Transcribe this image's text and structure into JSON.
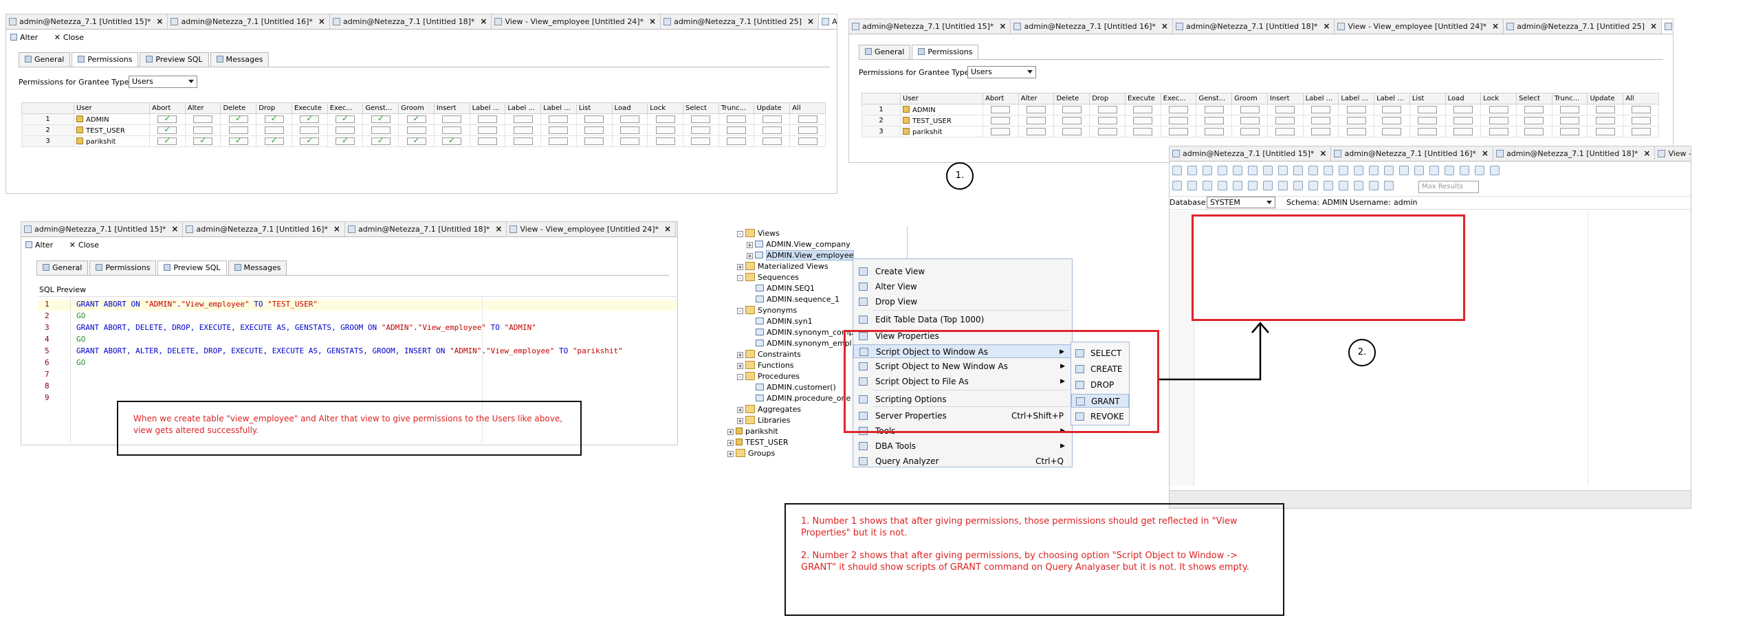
{
  "panel1": {
    "tabs": [
      "admin@Netezza_7.1 [Untitled 15]*",
      "admin@Netezza_7.1 [Untitled 16]*",
      "admin@Netezza_7.1 [Untitled 18]*",
      "View - View_employee [Untitled 24]*",
      "admin@Netezza_7.1 [Untitled 25]",
      "Alter: View: V"
    ],
    "toolbar": {
      "alter": "Alter",
      "close": "Close"
    },
    "subtabs": [
      "General",
      "Permissions",
      "Preview SQL",
      "Messages"
    ],
    "grantee_label": "Permissions for Grantee Type:",
    "grantee_value": "Users",
    "columns": [
      "User",
      "Abort",
      "Alter",
      "Delete",
      "Drop",
      "Execute",
      "Exec...",
      "Genst...",
      "Groom",
      "Insert",
      "Label ...",
      "Label ...",
      "Label ...",
      "List",
      "Load",
      "Lock",
      "Select",
      "Trunc...",
      "Update",
      "All"
    ],
    "rows": [
      {
        "num": "1",
        "user": "ADMIN",
        "checks": [
          1,
          0,
          1,
          1,
          1,
          1,
          1,
          1,
          0,
          0,
          0,
          0,
          0,
          0,
          0,
          0,
          0,
          0,
          0
        ]
      },
      {
        "num": "2",
        "user": "TEST_USER",
        "checks": [
          1,
          0,
          0,
          0,
          0,
          0,
          0,
          0,
          0,
          0,
          0,
          0,
          0,
          0,
          0,
          0,
          0,
          0,
          0
        ]
      },
      {
        "num": "3",
        "user": "parikshit",
        "checks": [
          1,
          1,
          1,
          1,
          1,
          1,
          1,
          1,
          1,
          0,
          0,
          0,
          0,
          0,
          0,
          0,
          0,
          0,
          0
        ]
      }
    ]
  },
  "panel2": {
    "tabs": [
      "admin@Netezza_7.1 [Untitled 15]*",
      "admin@Netezza_7.1 [Untitled 16]*",
      "admin@Netezza_7.1 [Untitled 18]*",
      "View - View_employee [Untitled 24]*",
      "admin@Netezza_7.1 [Untitled 25]",
      "Properties:"
    ],
    "subtabs": [
      "General",
      "Permissions"
    ],
    "grantee_label": "Permissions for Grantee Type:",
    "grantee_value": "Users",
    "columns": [
      "User",
      "Abort",
      "Alter",
      "Delete",
      "Drop",
      "Execute",
      "Exec...",
      "Genst...",
      "Groom",
      "Insert",
      "Label ...",
      "Label ...",
      "Label ...",
      "List",
      "Load",
      "Lock",
      "Select",
      "Trunc...",
      "Update",
      "All"
    ],
    "rows": [
      {
        "num": "1",
        "user": "ADMIN"
      },
      {
        "num": "2",
        "user": "TEST_USER"
      },
      {
        "num": "3",
        "user": "parikshit"
      }
    ]
  },
  "panel3": {
    "tabs": [
      "admin@Netezza_7.1 [Untitled 15]*",
      "admin@Netezza_7.1 [Untitled 16]*",
      "admin@Netezza_7.1 [Untitled 18]*",
      "View - View_employee [Untitled 24]*",
      "admin@Netezza_7.1 [Untitled 25]",
      "View - View_e"
    ],
    "database_label": "Database:",
    "database_value": "SYSTEM",
    "schema_label": "Schema:",
    "schema_value": "ADMIN",
    "username_label": "Username:",
    "username_value": "admin",
    "max_results_placeholder": "Max Results"
  },
  "panel4": {
    "tabs": [
      "admin@Netezza_7.1 [Untitled 15]*",
      "admin@Netezza_7.1 [Untitled 16]*",
      "admin@Netezza_7.1 [Untitled 18]*",
      "View - View_employee [Untitled 24]*",
      "admin@Netezza_7.1 [Untitled 25]"
    ],
    "toolbar": {
      "alter": "Alter",
      "close": "Close"
    },
    "subtabs": [
      "General",
      "Permissions",
      "Preview SQL",
      "Messages"
    ],
    "sql_preview_label": "SQL Preview",
    "lines": [
      {
        "n": "1",
        "parts": [
          [
            "kw",
            "GRANT ABORT ON "
          ],
          [
            "st",
            "\"ADMIN\""
          ],
          [
            "kw",
            "."
          ],
          [
            "st",
            "\"View_employee\""
          ],
          [
            "kw",
            " TO "
          ],
          [
            "st",
            "\"TEST_USER\""
          ]
        ]
      },
      {
        "n": "2",
        "parts": [
          [
            "go",
            "GO"
          ]
        ]
      },
      {
        "n": "3",
        "parts": [
          [
            "kw",
            "GRANT ABORT, DELETE, DROP, EXECUTE, EXECUTE AS, GENSTATS, GROOM ON "
          ],
          [
            "st",
            "\"ADMIN\""
          ],
          [
            "kw",
            "."
          ],
          [
            "st",
            "\"View_employee\""
          ],
          [
            "kw",
            " TO "
          ],
          [
            "st",
            "\"ADMIN\""
          ]
        ]
      },
      {
        "n": "4",
        "parts": [
          [
            "go",
            "GO"
          ]
        ]
      },
      {
        "n": "5",
        "parts": [
          [
            "kw",
            "GRANT ABORT, ALTER, DELETE, DROP, EXECUTE, EXECUTE AS, GENSTATS, GROOM, INSERT ON "
          ],
          [
            "st",
            "\"ADMIN\""
          ],
          [
            "kw",
            "."
          ],
          [
            "st",
            "\"View_employee\""
          ],
          [
            "kw",
            " TO "
          ],
          [
            "st",
            "\"parikshit\""
          ]
        ]
      },
      {
        "n": "6",
        "parts": [
          [
            "go",
            "GO"
          ]
        ]
      },
      {
        "n": "7",
        "parts": []
      },
      {
        "n": "8",
        "parts": []
      },
      {
        "n": "9",
        "parts": []
      }
    ]
  },
  "tree": {
    "items": [
      {
        "indent": 1,
        "label": "Views",
        "type": "folder",
        "exp": "-"
      },
      {
        "indent": 2,
        "label": "ADMIN.View_company",
        "type": "view",
        "exp": "+"
      },
      {
        "indent": 2,
        "label": "ADMIN.View_employee",
        "type": "view",
        "exp": "+",
        "selected": true
      },
      {
        "indent": 1,
        "label": "Materialized Views",
        "type": "folder",
        "exp": "+"
      },
      {
        "indent": 1,
        "label": "Sequences",
        "type": "folder",
        "exp": "-"
      },
      {
        "indent": 2,
        "label": "ADMIN.SEQ1",
        "type": "view",
        "exp": ""
      },
      {
        "indent": 2,
        "label": "ADMIN.sequence_1",
        "type": "view",
        "exp": ""
      },
      {
        "indent": 1,
        "label": "Synonyms",
        "type": "folder",
        "exp": "-"
      },
      {
        "indent": 2,
        "label": "ADMIN.syn1",
        "type": "view",
        "exp": ""
      },
      {
        "indent": 2,
        "label": "ADMIN.synonym_comp",
        "type": "view",
        "exp": ""
      },
      {
        "indent": 2,
        "label": "ADMIN.synonym_empl",
        "type": "view",
        "exp": ""
      },
      {
        "indent": 1,
        "label": "Constraints",
        "type": "folder",
        "exp": "+"
      },
      {
        "indent": 1,
        "label": "Functions",
        "type": "folder",
        "exp": "+"
      },
      {
        "indent": 1,
        "label": "Procedures",
        "type": "folder",
        "exp": "-"
      },
      {
        "indent": 2,
        "label": "ADMIN.customer()",
        "type": "view",
        "exp": ""
      },
      {
        "indent": 2,
        "label": "ADMIN.procedure_one",
        "type": "view",
        "exp": ""
      },
      {
        "indent": 1,
        "label": "Aggregates",
        "type": "folder",
        "exp": "+"
      },
      {
        "indent": 1,
        "label": "Libraries",
        "type": "folder",
        "exp": "+"
      },
      {
        "indent": 0,
        "label": "parikshit",
        "type": "user",
        "exp": "+"
      },
      {
        "indent": 0,
        "label": "TEST_USER",
        "type": "user",
        "exp": "+"
      },
      {
        "indent": 0,
        "label": "Groups",
        "type": "folder",
        "exp": "+"
      }
    ]
  },
  "context_menu": {
    "items": [
      {
        "label": "Create View",
        "shortcut": "",
        "arrow": false
      },
      {
        "label": "Alter View",
        "shortcut": "",
        "arrow": false
      },
      {
        "label": "Drop View",
        "shortcut": "",
        "arrow": false
      },
      {
        "label": "Edit Table Data (Top 1000)",
        "shortcut": "",
        "arrow": false
      },
      {
        "label": "View Properties",
        "shortcut": "",
        "arrow": false
      },
      {
        "label": "Script Object to Window As",
        "shortcut": "",
        "arrow": true,
        "highlight": true
      },
      {
        "label": "Script Object to New Window As",
        "shortcut": "",
        "arrow": true
      },
      {
        "label": "Script Object to File As",
        "shortcut": "",
        "arrow": true
      },
      {
        "label": "Scripting Options",
        "shortcut": "",
        "arrow": false
      },
      {
        "label": "Server Properties",
        "shortcut": "Ctrl+Shift+P",
        "arrow": false
      },
      {
        "label": "Tools",
        "shortcut": "",
        "arrow": true
      },
      {
        "label": "DBA Tools",
        "shortcut": "",
        "arrow": true
      },
      {
        "label": "Query Analyzer",
        "shortcut": "Ctrl+Q",
        "arrow": false
      }
    ]
  },
  "submenu": {
    "items": [
      {
        "label": "SELECT"
      },
      {
        "label": "CREATE"
      },
      {
        "label": "DROP"
      },
      {
        "label": "GRANT",
        "highlight": true
      },
      {
        "label": "REVOKE"
      }
    ]
  },
  "annotations": {
    "circle1": "1.",
    "circle2": "2.",
    "note_left": "When we create table \"view_employee\" and Alter that view to give permissions to the Users like above, view gets altered successfully.",
    "note_bottom_1": "1. Number 1 shows that after giving permissions, those permissions should get reflected in \"View Properties\" but it is not.",
    "note_bottom_2": "2. Number 2 shows that after giving permissions, by choosing option \"Script Object to Window -> GRANT\" it should show scripts of GRANT command on Query Analyaser  but it is not. It shows empty."
  },
  "colors": {
    "annotation_red": "#e0242a",
    "check_green": "#2e9b2e",
    "keyword_blue": "#0000cc",
    "string_red": "#c00000"
  }
}
